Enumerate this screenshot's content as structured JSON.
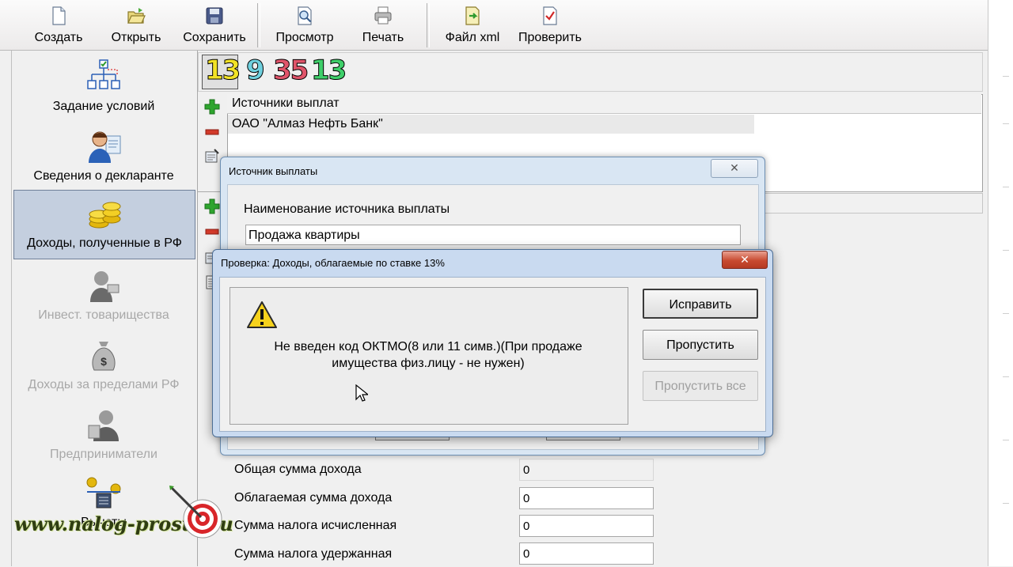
{
  "toolbar": {
    "buttons": [
      {
        "label": "Создать",
        "icon": "new-document-icon"
      },
      {
        "label": "Открыть",
        "icon": "open-folder-icon"
      },
      {
        "label": "Сохранить",
        "icon": "save-disk-icon"
      },
      {
        "label": "Просмотр",
        "icon": "preview-magnifier-icon"
      },
      {
        "label": "Печать",
        "icon": "printer-icon"
      },
      {
        "label": "Файл xml",
        "icon": "xml-file-icon"
      },
      {
        "label": "Проверить",
        "icon": "check-document-icon"
      }
    ]
  },
  "sidebar": {
    "items": [
      {
        "label": "Задание условий",
        "icon": "conditions-tree-icon",
        "state": "normal"
      },
      {
        "label": "Сведения о декларанте",
        "icon": "declarant-person-icon",
        "state": "normal"
      },
      {
        "label": "Доходы, полученные в РФ",
        "icon": "coins-icon",
        "state": "active"
      },
      {
        "label": "Инвест. товарищества",
        "icon": "investor-person-icon",
        "state": "disabled"
      },
      {
        "label": "Доходы за пределами РФ",
        "icon": "money-bag-icon",
        "state": "disabled"
      },
      {
        "label": "Предприниматели",
        "icon": "entrepreneur-icon",
        "state": "disabled"
      },
      {
        "label": "Вычеты",
        "icon": "deductions-scale-icon",
        "state": "normal"
      }
    ]
  },
  "rates": {
    "items": [
      {
        "value": "13",
        "color": "#f2e226"
      },
      {
        "value": "9",
        "color": "#6fd0de"
      },
      {
        "value": "35",
        "color": "#e0546a"
      },
      {
        "value": "13",
        "color": "#3fcf6a"
      }
    ]
  },
  "sources_grid": {
    "header": "Источники выплат",
    "rows": [
      "ОАО \"Алмаз Нефть Банк\""
    ]
  },
  "summary": {
    "rows": [
      {
        "label": "Общая сумма дохода",
        "value": "0"
      },
      {
        "label": "Облагаемая сумма дохода",
        "value": "0"
      },
      {
        "label": "Сумма налога исчисленная",
        "value": "0"
      },
      {
        "label": "Сумма налога удержанная",
        "value": "0"
      }
    ]
  },
  "source_dialog": {
    "title": "Источник выплаты",
    "name_label": "Наименование источника выплаты",
    "name_value": "Продажа квартиры"
  },
  "check_dialog": {
    "title": "Проверка: Доходы, облагаемые по ставке 13%",
    "message_line1": "Не введен код ОКТМО(8 или 11 симв.)(При продаже",
    "message_line2": "имущества физ.лицу - не нужен)",
    "buttons": {
      "fix": "Исправить",
      "skip": "Пропустить",
      "skip_all": "Пропустить все"
    }
  },
  "watermark": "www.nalog-prosto.ru",
  "colors": {
    "accent_selection": "#c4cfdf",
    "dialog_frame": "#c9daf0",
    "close_red": "#c84a30"
  }
}
